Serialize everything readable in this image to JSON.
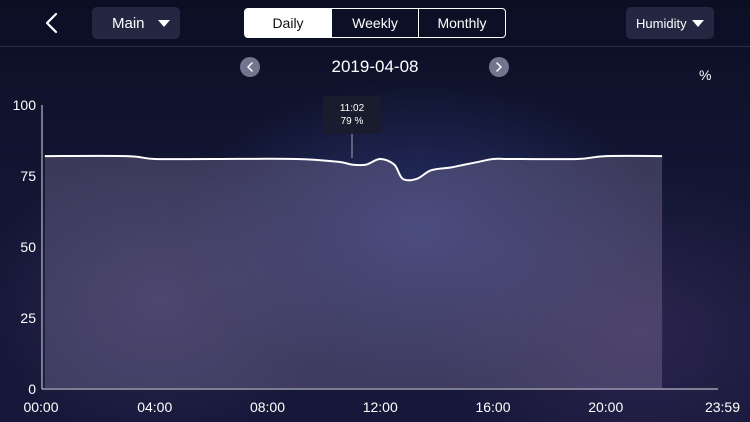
{
  "header": {
    "location_select": "Main",
    "tabs": [
      {
        "label": "Daily",
        "active": true
      },
      {
        "label": "Weekly",
        "active": false
      },
      {
        "label": "Monthly",
        "active": false
      }
    ],
    "metric_select": "Humidity"
  },
  "date_nav": {
    "date": "2019-04-08"
  },
  "tooltip": {
    "time": "11:02",
    "value": "79 %"
  },
  "chart_data": {
    "type": "area",
    "unit_label": "%",
    "ylim": [
      0,
      100
    ],
    "y_ticks": [
      "0",
      "25",
      "50",
      "75",
      "100"
    ],
    "x_ticks": [
      "00:00",
      "04:00",
      "08:00",
      "12:00",
      "16:00",
      "20:00",
      "23:59"
    ],
    "xlim_hours": [
      0,
      23.983
    ],
    "series": [
      {
        "x_hours": [
          0.1,
          3.0,
          4.0,
          6.0,
          9.0,
          10.5,
          11.0,
          11.5,
          12.0,
          12.5,
          12.8,
          13.3,
          13.8,
          14.5,
          15.0,
          15.5,
          16.0,
          16.5,
          17.0,
          19.0,
          20.0,
          22.0
        ],
        "y": [
          82,
          82,
          81,
          81,
          81,
          80,
          79,
          79,
          81,
          79,
          74,
          74,
          77,
          78,
          79,
          80,
          81,
          81,
          81,
          81,
          82,
          82
        ]
      }
    ],
    "colors": {
      "line": "#ffffff",
      "fill": "rgba(140,130,170,0.35)"
    },
    "grid": false
  }
}
